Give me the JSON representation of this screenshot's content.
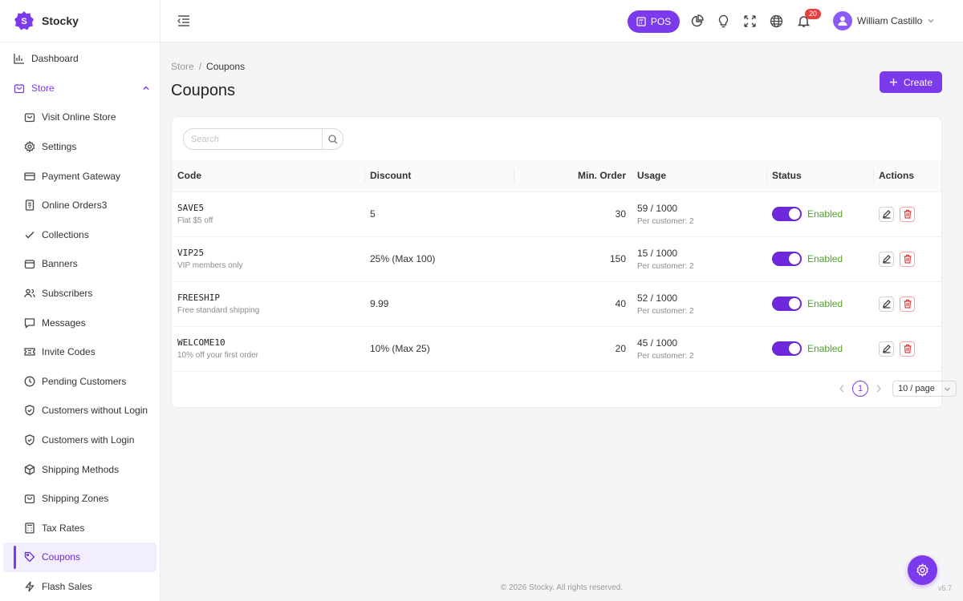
{
  "app": {
    "name": "Stocky"
  },
  "sidebar": {
    "dashboard": "Dashboard",
    "store": "Store",
    "items": [
      {
        "label": "Visit Online Store",
        "icon": "store-bag-icon"
      },
      {
        "label": "Settings",
        "icon": "gear-icon"
      },
      {
        "label": "Payment Gateway",
        "icon": "credit-card-icon"
      },
      {
        "label": "Online Orders3",
        "icon": "receipt-icon"
      },
      {
        "label": "Collections",
        "icon": "check-icon"
      },
      {
        "label": "Banners",
        "icon": "bag-icon"
      },
      {
        "label": "Subscribers",
        "icon": "users-icon"
      },
      {
        "label": "Messages",
        "icon": "message-icon"
      },
      {
        "label": "Invite Codes",
        "icon": "ticket-icon"
      },
      {
        "label": "Pending Customers",
        "icon": "clock-icon"
      },
      {
        "label": "Customers without Login",
        "icon": "shield-icon"
      },
      {
        "label": "Customers with Login",
        "icon": "shield-check-icon"
      },
      {
        "label": "Shipping Methods",
        "icon": "box-icon"
      },
      {
        "label": "Shipping Zones",
        "icon": "bag-icon"
      },
      {
        "label": "Tax Rates",
        "icon": "calculator-icon"
      },
      {
        "label": "Coupons",
        "icon": "tag-icon"
      },
      {
        "label": "Flash Sales",
        "icon": "bolt-icon"
      }
    ]
  },
  "header": {
    "pos_label": "POS",
    "notification_count": "20",
    "user_name": "William Castillo"
  },
  "breadcrumb": {
    "parent": "Store",
    "separator": "/",
    "current": "Coupons"
  },
  "page": {
    "title": "Coupons",
    "create_label": "Create"
  },
  "search": {
    "placeholder": "Search"
  },
  "table": {
    "headers": {
      "code": "Code",
      "discount": "Discount",
      "min_order": "Min. Order",
      "usage": "Usage",
      "status": "Status",
      "actions": "Actions"
    },
    "rows": [
      {
        "code": "SAVE5",
        "desc": "Flat $5 off",
        "discount": "5",
        "min_order": "30",
        "usage": "59 / 1000",
        "per": "Per customer: 2",
        "status": "Enabled",
        "enabled": true
      },
      {
        "code": "VIP25",
        "desc": "VIP members only",
        "discount": "25% (Max 100)",
        "min_order": "150",
        "usage": "15 / 1000",
        "per": "Per customer: 2",
        "status": "Enabled",
        "enabled": true
      },
      {
        "code": "FREESHIP",
        "desc": "Free standard shipping",
        "discount": "9.99",
        "min_order": "40",
        "usage": "52 / 1000",
        "per": "Per customer: 2",
        "status": "Enabled",
        "enabled": true
      },
      {
        "code": "WELCOME10",
        "desc": "10% off your first order",
        "discount": "10% (Max 25)",
        "min_order": "20",
        "usage": "45 / 1000",
        "per": "Per customer: 2",
        "status": "Enabled",
        "enabled": true
      }
    ]
  },
  "pagination": {
    "current_page": "1",
    "page_size": "10 / page"
  },
  "footer": {
    "copyright": "© 2026 Stocky. All rights reserved.",
    "version": "v5.7"
  },
  "colors": {
    "accent": "#7c3aed",
    "enabled": "#52a32c",
    "danger": "#e53e3e"
  }
}
